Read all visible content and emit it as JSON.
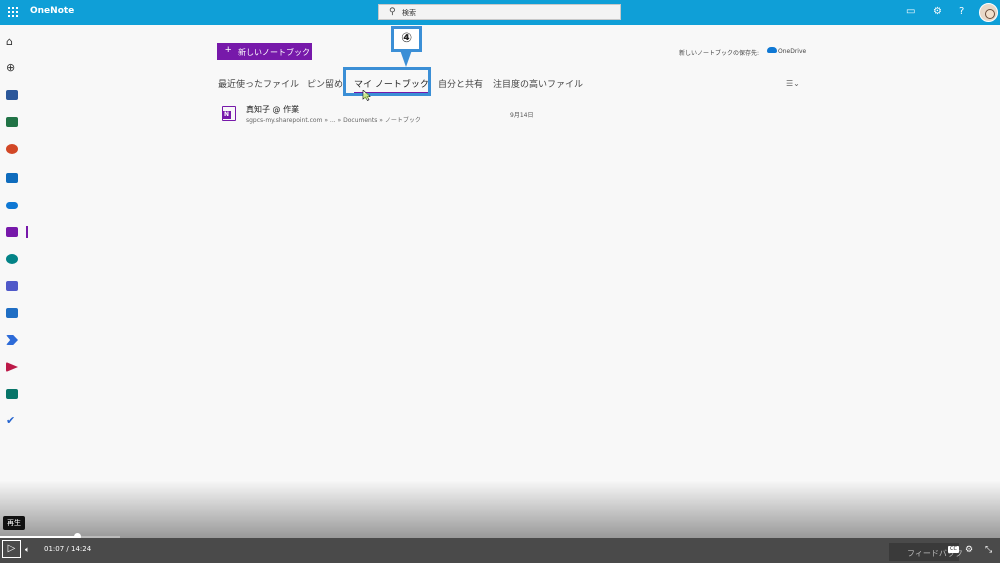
{
  "app": {
    "name": "OneNote"
  },
  "search": {
    "placeholder": "検索"
  },
  "header_icons": [
    "feedback-icon",
    "settings-icon",
    "help-icon",
    "avatar"
  ],
  "header_help": "?",
  "rail": [
    "home-icon",
    "create-icon",
    "word-icon",
    "excel-icon",
    "powerpoint-icon",
    "outlook-icon",
    "onedrive-icon",
    "onenote-icon",
    "sharepoint-icon",
    "teams-icon",
    "sway-icon",
    "power-automate-icon",
    "stream-icon",
    "forms-icon",
    "todo-icon"
  ],
  "toolbar": {
    "new_notebook": "新しいノートブック",
    "save_location_label": "新しいノートブックの保存先:",
    "save_location": "OneDrive"
  },
  "tabs": [
    {
      "label": "最近使ったファイル",
      "active": false
    },
    {
      "label": "ピン留め",
      "active": false
    },
    {
      "label": "マイ ノートブック",
      "active": true
    },
    {
      "label": "自分と共有",
      "active": false
    },
    {
      "label": "注目度の高いファイル",
      "active": false
    }
  ],
  "callout": {
    "number": "④"
  },
  "notebooks": [
    {
      "title": "真知子 @ 作業",
      "path": "sgpcs-my.sharepoint.com » ... » Documents » ノートブック",
      "date": "9月14日"
    }
  ],
  "player": {
    "tooltip": "再生",
    "current_time": "01:07",
    "separator": "/",
    "total_time": "14:24",
    "progress_fraction": 0.077,
    "feedback_label": "フィードバック",
    "cc_label": "CC"
  },
  "colors": {
    "topbar": "#0f9fd7",
    "accent": "#7719aa",
    "callout": "#3b8fd6"
  }
}
